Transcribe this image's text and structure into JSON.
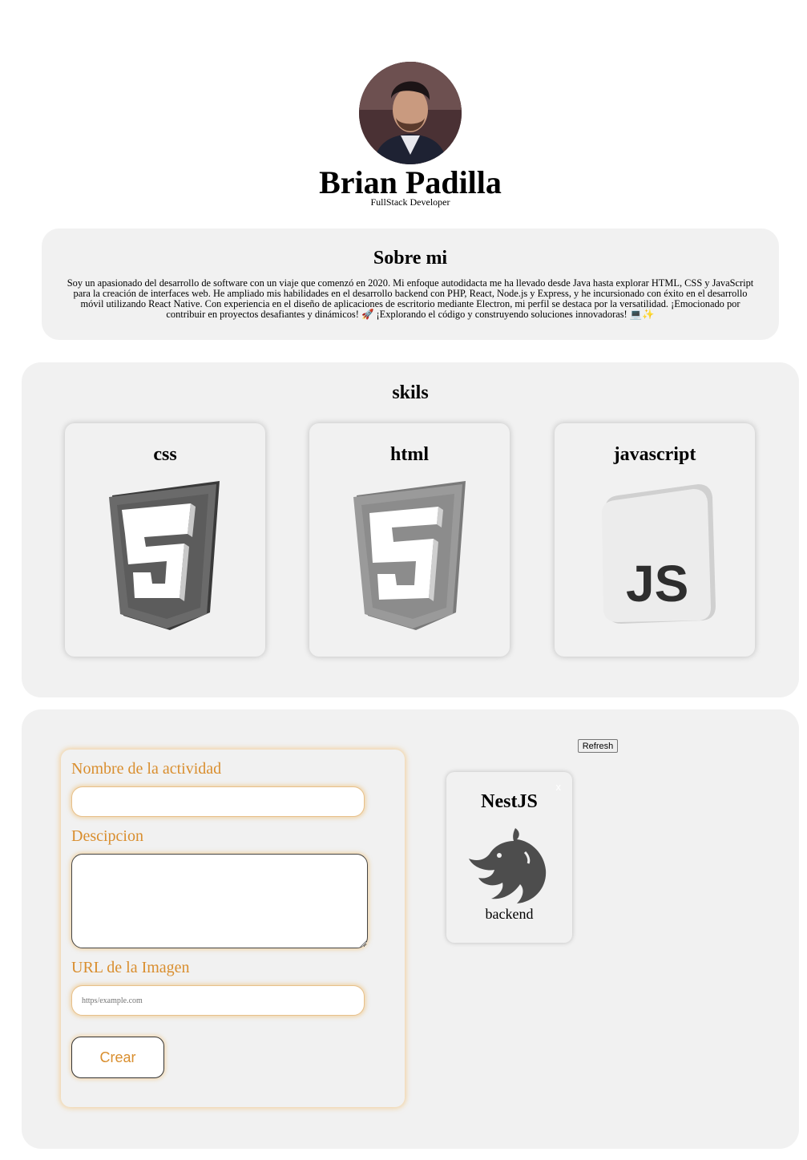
{
  "profile": {
    "name": "Brian Padilla",
    "role": "FullStack Developer"
  },
  "about": {
    "title": "Sobre mi",
    "text": "Soy un apasionado del desarrollo de software con un viaje que comenzó en 2020. Mi enfoque autodidacta me ha llevado desde Java hasta explorar HTML, CSS y JavaScript para la creación de interfaces web. He ampliado mis habilidades en el desarrollo backend con PHP, React, Node.js y Express, y he incursionado con éxito en el desarrollo móvil utilizando React Native. Con experiencia en el diseño de aplicaciones de escritorio mediante Electron, mi perfil se destaca por la versatilidad. ¡Emocionado por contribuir en proyectos desafiantes y dinámicos! 🚀 ¡Explorando el código y construyendo soluciones innovadoras! 💻✨"
  },
  "skills": {
    "title": "skils",
    "items": [
      {
        "label": "css",
        "icon": "css3-icon"
      },
      {
        "label": "html",
        "icon": "html5-icon"
      },
      {
        "label": "javascript",
        "icon": "js-icon"
      }
    ]
  },
  "form": {
    "name_label": "Nombre de la actividad",
    "name_value": "",
    "desc_label": "Descipcion",
    "desc_value": "",
    "url_label": "URL de la Imagen",
    "url_placeholder": "https/example.com",
    "submit_label": "Crear"
  },
  "activities": {
    "refresh_label": "Refresh",
    "items": [
      {
        "title": "NestJS",
        "category": "backend",
        "close_label": "x",
        "icon": "nestjs-icon"
      }
    ]
  },
  "colors": {
    "accent": "#d98e2e",
    "panel": "#f1f1f1"
  }
}
